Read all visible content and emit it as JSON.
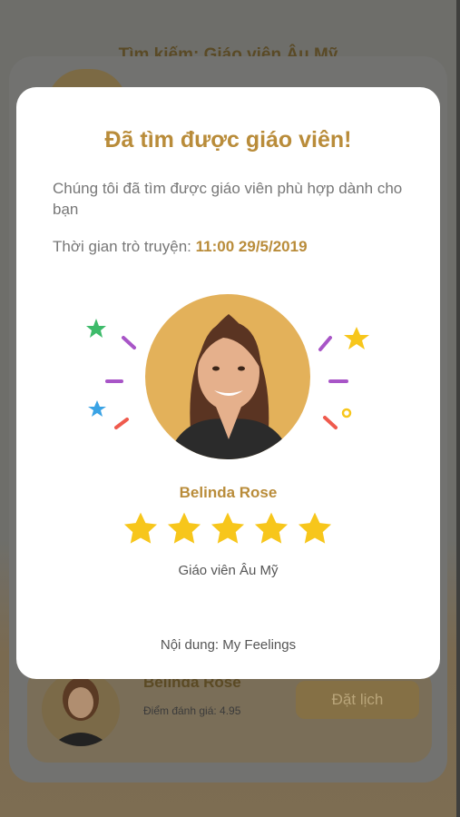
{
  "background": {
    "title": "Tìm kiếm: Giáo viên Âu Mỹ",
    "card": {
      "teacher_name": "Belinda Rose",
      "rating_text": "Điểm đánh giá: 4.95",
      "book_button": "Đặt lịch"
    }
  },
  "modal": {
    "title": "Đã tìm được giáo viên!",
    "description": "Chúng tôi đã tìm được giáo viên phù hợp dành cho bạn",
    "time_label": "Thời gian trò truyện:",
    "time_value": "11:00",
    "date_value": "29/5/2019",
    "teacher_name": "Belinda Rose",
    "rating": 5,
    "teacher_type": "Giáo viên Âu Mỹ",
    "content_text": "Nội dung: My Feelings"
  },
  "colors": {
    "accent": "#b98c3a",
    "star": "#f7c61b",
    "photo_bg": "#e3b15a"
  }
}
